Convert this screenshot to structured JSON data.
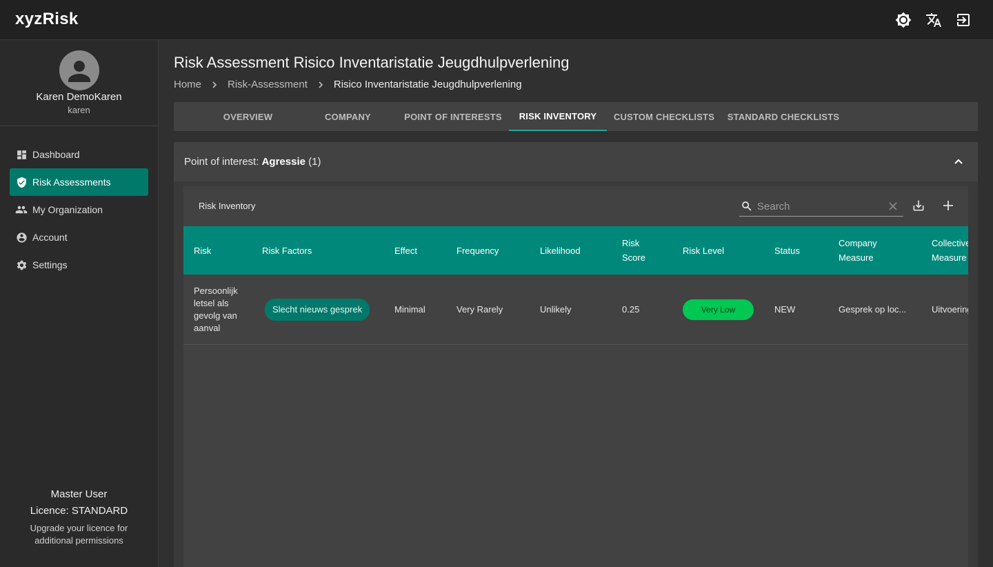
{
  "app": {
    "logo": "xyzRisk"
  },
  "topbar": {
    "icons": [
      "brightness-icon",
      "translate-icon",
      "logout-icon"
    ]
  },
  "user": {
    "name": "Karen DemoKaren",
    "handle": "karen"
  },
  "nav": [
    {
      "label": "Dashboard",
      "icon": "dashboard-icon",
      "active": false
    },
    {
      "label": "Risk Assessments",
      "icon": "shield-check-icon",
      "active": true
    },
    {
      "label": "My Organization",
      "icon": "people-icon",
      "active": false
    },
    {
      "label": "Account",
      "icon": "account-circle-icon",
      "active": false
    },
    {
      "label": "Settings",
      "icon": "gear-icon",
      "active": false
    }
  ],
  "licence": {
    "role": "Master User",
    "type": "Licence: STANDARD",
    "note": "Upgrade your licence for additional permissions"
  },
  "page": {
    "title": "Risk Assessment Risico Inventaristatie Jeugdhulpverlening",
    "breadcrumb": [
      "Home",
      "Risk-Assessment",
      "Risico Inventaristatie Jeugdhulpverlening"
    ]
  },
  "tabs": [
    {
      "label": "OVERVIEW",
      "active": false
    },
    {
      "label": "COMPANY",
      "active": false
    },
    {
      "label": "POINT OF INTERESTS",
      "active": false
    },
    {
      "label": "RISK INVENTORY",
      "active": true
    },
    {
      "label": "CUSTOM CHECKLISTS",
      "active": false
    },
    {
      "label": "STANDARD CHECKLISTS",
      "active": false
    }
  ],
  "poi": {
    "prefix": "Point of interest:",
    "name": "Agressie",
    "count": "(1)"
  },
  "inventory": {
    "title": "Risk Inventory",
    "search_placeholder": "Search",
    "columns": [
      "Risk",
      "Risk Factors",
      "Effect",
      "Frequency",
      "Likelihood",
      "Risk\nScore",
      "Risk Level",
      "Status",
      "Company\nMeasure",
      "Collective\nMeasure"
    ],
    "rows": [
      {
        "risk": "Persoonlijk letsel als gevolg van aanval",
        "risk_factor": "Slecht nieuws gesprek",
        "effect": "Minimal",
        "frequency": "Very Rarely",
        "likelihood": "Unlikely",
        "risk_score": "0.25",
        "risk_level": "Very Low",
        "status": "NEW",
        "company_measure": "Gesprek op loc...",
        "collective_measure": "Uitvoering"
      }
    ]
  },
  "colors": {
    "accent": "#00796b",
    "table_header": "#00897b",
    "risk_level_very_low": "#00c853",
    "active_tab_indicator": "#26a69a"
  }
}
